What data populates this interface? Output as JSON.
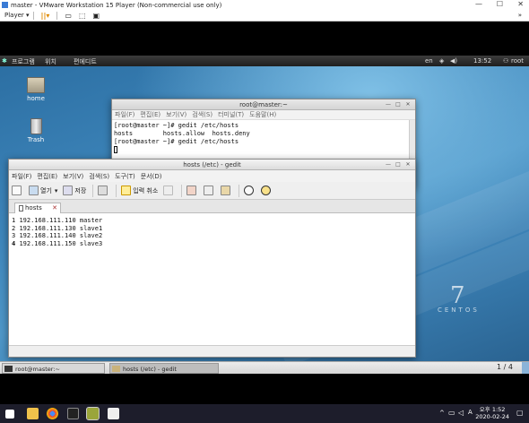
{
  "vmware": {
    "title": "master - VMware Workstation 15 Player (Non-commercial use only)",
    "player_label": "Player ▾",
    "pause_label": "||▾"
  },
  "gnome_panel": {
    "applications": "프로그램",
    "places": "위치",
    "editor": "편에디트",
    "lang": "en",
    "time": "13:52",
    "user": "root"
  },
  "desktop": {
    "icons": [
      {
        "label": "home"
      },
      {
        "label": "Trash"
      }
    ],
    "watermark": "CENTOS",
    "watermark_num": "7"
  },
  "terminal": {
    "title": "root@master:~",
    "menu": [
      "파일(F)",
      "편집(E)",
      "보기(V)",
      "검색(S)",
      "터미널(T)",
      "도움말(H)"
    ],
    "lines": [
      "[root@master ~]# gedit /etc/hosts",
      "hosts        hosts.allow  hosts.deny",
      "[root@master ~]# gedit /etc/hosts"
    ]
  },
  "gedit": {
    "title": "hosts (/etc) - gedit",
    "menu": [
      "파일(F)",
      "편집(E)",
      "보기(V)",
      "검색(S)",
      "도구(T)",
      "문서(D)"
    ],
    "toolbar": {
      "open": "열기",
      "save": "저장",
      "undo": "입력 취소"
    },
    "tab": "hosts",
    "lines": [
      {
        "num": "1",
        "text": "192.168.111.110 master"
      },
      {
        "num": "2",
        "text": "192.168.111.130 slave1"
      },
      {
        "num": "3",
        "text": "192.168.111.140 slave2"
      },
      {
        "num": "4",
        "text": "192.168.111.150 slave3"
      }
    ]
  },
  "bottom_panel": {
    "task1": "root@master:~",
    "task2": "hosts (/etc) - gedit",
    "workspace": "1 / 4"
  },
  "windows_taskbar": {
    "time": "오후 1:52",
    "date": "2020-02-24"
  }
}
